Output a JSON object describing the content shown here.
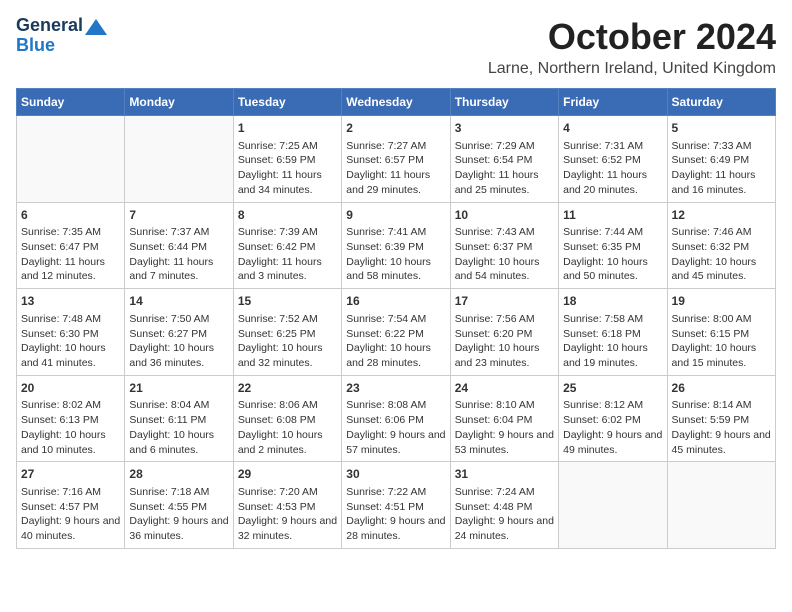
{
  "header": {
    "logo_line1": "General",
    "logo_line2": "Blue",
    "month_title": "October 2024",
    "location": "Larne, Northern Ireland, United Kingdom"
  },
  "days_of_week": [
    "Sunday",
    "Monday",
    "Tuesday",
    "Wednesday",
    "Thursday",
    "Friday",
    "Saturday"
  ],
  "weeks": [
    [
      {
        "day": "",
        "detail": ""
      },
      {
        "day": "",
        "detail": ""
      },
      {
        "day": "1",
        "detail": "Sunrise: 7:25 AM\nSunset: 6:59 PM\nDaylight: 11 hours and 34 minutes."
      },
      {
        "day": "2",
        "detail": "Sunrise: 7:27 AM\nSunset: 6:57 PM\nDaylight: 11 hours and 29 minutes."
      },
      {
        "day": "3",
        "detail": "Sunrise: 7:29 AM\nSunset: 6:54 PM\nDaylight: 11 hours and 25 minutes."
      },
      {
        "day": "4",
        "detail": "Sunrise: 7:31 AM\nSunset: 6:52 PM\nDaylight: 11 hours and 20 minutes."
      },
      {
        "day": "5",
        "detail": "Sunrise: 7:33 AM\nSunset: 6:49 PM\nDaylight: 11 hours and 16 minutes."
      }
    ],
    [
      {
        "day": "6",
        "detail": "Sunrise: 7:35 AM\nSunset: 6:47 PM\nDaylight: 11 hours and 12 minutes."
      },
      {
        "day": "7",
        "detail": "Sunrise: 7:37 AM\nSunset: 6:44 PM\nDaylight: 11 hours and 7 minutes."
      },
      {
        "day": "8",
        "detail": "Sunrise: 7:39 AM\nSunset: 6:42 PM\nDaylight: 11 hours and 3 minutes."
      },
      {
        "day": "9",
        "detail": "Sunrise: 7:41 AM\nSunset: 6:39 PM\nDaylight: 10 hours and 58 minutes."
      },
      {
        "day": "10",
        "detail": "Sunrise: 7:43 AM\nSunset: 6:37 PM\nDaylight: 10 hours and 54 minutes."
      },
      {
        "day": "11",
        "detail": "Sunrise: 7:44 AM\nSunset: 6:35 PM\nDaylight: 10 hours and 50 minutes."
      },
      {
        "day": "12",
        "detail": "Sunrise: 7:46 AM\nSunset: 6:32 PM\nDaylight: 10 hours and 45 minutes."
      }
    ],
    [
      {
        "day": "13",
        "detail": "Sunrise: 7:48 AM\nSunset: 6:30 PM\nDaylight: 10 hours and 41 minutes."
      },
      {
        "day": "14",
        "detail": "Sunrise: 7:50 AM\nSunset: 6:27 PM\nDaylight: 10 hours and 36 minutes."
      },
      {
        "day": "15",
        "detail": "Sunrise: 7:52 AM\nSunset: 6:25 PM\nDaylight: 10 hours and 32 minutes."
      },
      {
        "day": "16",
        "detail": "Sunrise: 7:54 AM\nSunset: 6:22 PM\nDaylight: 10 hours and 28 minutes."
      },
      {
        "day": "17",
        "detail": "Sunrise: 7:56 AM\nSunset: 6:20 PM\nDaylight: 10 hours and 23 minutes."
      },
      {
        "day": "18",
        "detail": "Sunrise: 7:58 AM\nSunset: 6:18 PM\nDaylight: 10 hours and 19 minutes."
      },
      {
        "day": "19",
        "detail": "Sunrise: 8:00 AM\nSunset: 6:15 PM\nDaylight: 10 hours and 15 minutes."
      }
    ],
    [
      {
        "day": "20",
        "detail": "Sunrise: 8:02 AM\nSunset: 6:13 PM\nDaylight: 10 hours and 10 minutes."
      },
      {
        "day": "21",
        "detail": "Sunrise: 8:04 AM\nSunset: 6:11 PM\nDaylight: 10 hours and 6 minutes."
      },
      {
        "day": "22",
        "detail": "Sunrise: 8:06 AM\nSunset: 6:08 PM\nDaylight: 10 hours and 2 minutes."
      },
      {
        "day": "23",
        "detail": "Sunrise: 8:08 AM\nSunset: 6:06 PM\nDaylight: 9 hours and 57 minutes."
      },
      {
        "day": "24",
        "detail": "Sunrise: 8:10 AM\nSunset: 6:04 PM\nDaylight: 9 hours and 53 minutes."
      },
      {
        "day": "25",
        "detail": "Sunrise: 8:12 AM\nSunset: 6:02 PM\nDaylight: 9 hours and 49 minutes."
      },
      {
        "day": "26",
        "detail": "Sunrise: 8:14 AM\nSunset: 5:59 PM\nDaylight: 9 hours and 45 minutes."
      }
    ],
    [
      {
        "day": "27",
        "detail": "Sunrise: 7:16 AM\nSunset: 4:57 PM\nDaylight: 9 hours and 40 minutes."
      },
      {
        "day": "28",
        "detail": "Sunrise: 7:18 AM\nSunset: 4:55 PM\nDaylight: 9 hours and 36 minutes."
      },
      {
        "day": "29",
        "detail": "Sunrise: 7:20 AM\nSunset: 4:53 PM\nDaylight: 9 hours and 32 minutes."
      },
      {
        "day": "30",
        "detail": "Sunrise: 7:22 AM\nSunset: 4:51 PM\nDaylight: 9 hours and 28 minutes."
      },
      {
        "day": "31",
        "detail": "Sunrise: 7:24 AM\nSunset: 4:48 PM\nDaylight: 9 hours and 24 minutes."
      },
      {
        "day": "",
        "detail": ""
      },
      {
        "day": "",
        "detail": ""
      }
    ]
  ]
}
